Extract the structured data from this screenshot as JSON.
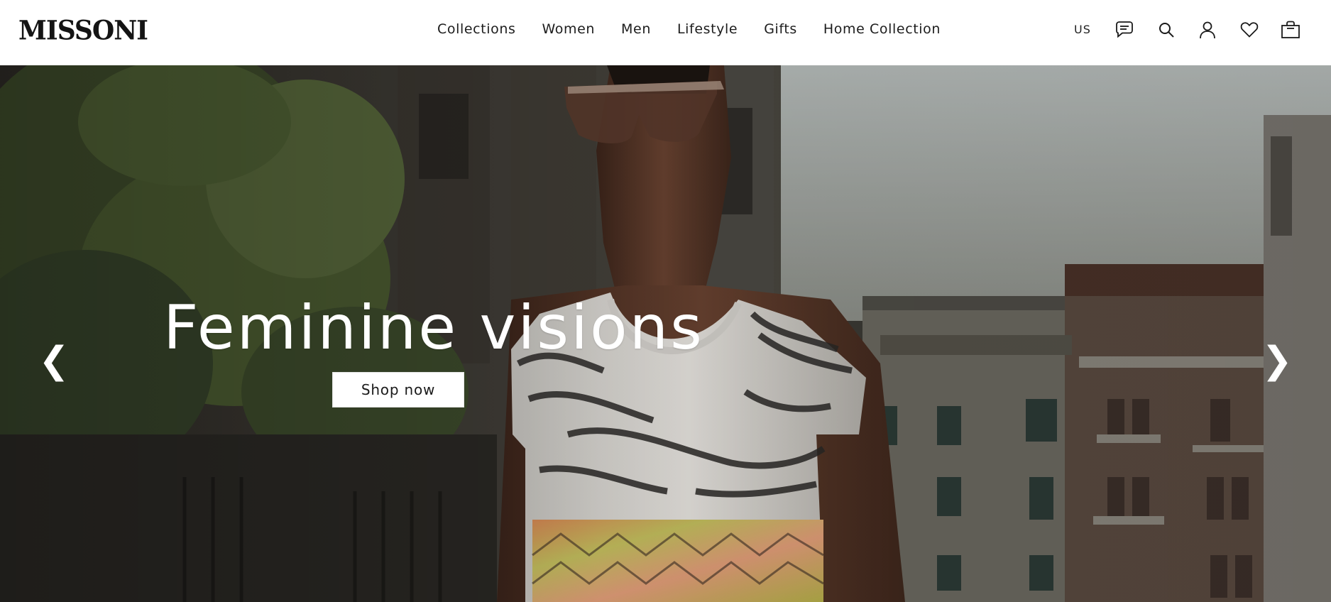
{
  "brand": {
    "logo_text": "MISSONI"
  },
  "nav": {
    "items": [
      {
        "label": "Collections"
      },
      {
        "label": "Women"
      },
      {
        "label": "Men"
      },
      {
        "label": "Lifestyle"
      },
      {
        "label": "Gifts"
      },
      {
        "label": "Home Collection"
      }
    ]
  },
  "utilities": {
    "country": "US",
    "icons": [
      "chat-icon",
      "search-icon",
      "account-icon",
      "wishlist-icon",
      "bag-icon"
    ]
  },
  "hero": {
    "headline": "Feminine visions",
    "cta_label": "Shop now",
    "prev_arrow": "❮",
    "next_arrow": "❯"
  },
  "colors": {
    "header_bg": "#ffffff",
    "text": "#111111",
    "cta_bg": "#ffffff",
    "hero_text": "#ffffff"
  }
}
